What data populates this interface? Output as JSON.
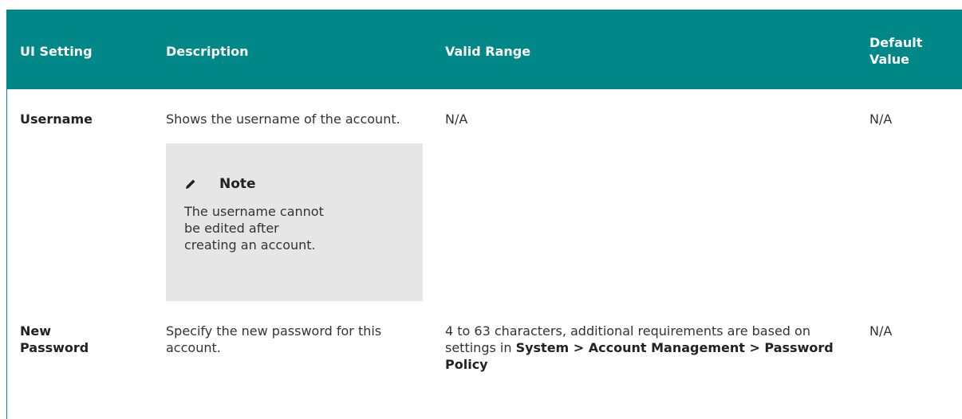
{
  "header": {
    "col1": "UI Setting",
    "col2": "Description",
    "col3": "Valid Range",
    "col4_line1": "Default",
    "col4_line2": "Value"
  },
  "rows": [
    {
      "setting": "Username",
      "description": "Shows the username of the account.",
      "note_title": "Note",
      "note_text": "The username cannot be edited after creating an account.",
      "range": "N/A",
      "default": "N/A"
    },
    {
      "setting_line1": "New",
      "setting_line2": "Password",
      "description": "Specify the new password for this account.",
      "range_text": "4 to 63 characters, additional requirements are based on settings in ",
      "range_bold": "System > Account Management > Password Policy",
      "default": "N/A"
    }
  ],
  "icons": {
    "note": "pencil-icon"
  },
  "colors": {
    "header_bg": "#008787",
    "note_bg": "#e6e6e6"
  }
}
